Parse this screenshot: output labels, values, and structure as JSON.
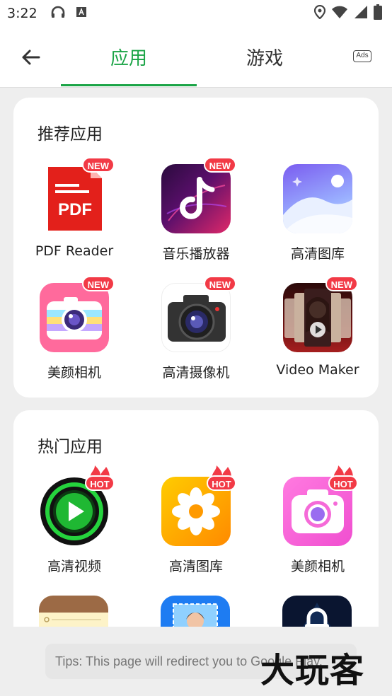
{
  "status_bar": {
    "time": "3:22"
  },
  "header": {
    "back_icon": "arrow-left-icon",
    "tabs": [
      {
        "label": "应用",
        "active": true
      },
      {
        "label": "游戏",
        "active": false
      }
    ],
    "ads_label": "Ads"
  },
  "colors": {
    "accent": "#1aa446",
    "badge": "#f23a46"
  },
  "sections": [
    {
      "title": "推荐应用",
      "apps": [
        {
          "label": "PDF Reader",
          "badge": "NEW",
          "icon": "pdf-icon"
        },
        {
          "label": "音乐播放器",
          "badge": "NEW",
          "icon": "music-note-icon"
        },
        {
          "label": "高清图库",
          "badge": "",
          "icon": "gallery-icon"
        },
        {
          "label": "美颜相机",
          "badge": "NEW",
          "icon": "beauty-camera-icon"
        },
        {
          "label": "高清摄像机",
          "badge": "NEW",
          "icon": "camera-icon"
        },
        {
          "label": "Video Maker",
          "badge": "NEW",
          "icon": "video-maker-icon"
        }
      ]
    },
    {
      "title": "热门应用",
      "apps": [
        {
          "label": "高清视频",
          "badge": "HOT",
          "icon": "play-icon"
        },
        {
          "label": "高清图库",
          "badge": "HOT",
          "icon": "flower-icon"
        },
        {
          "label": "美颜相机",
          "badge": "HOT",
          "icon": "camera-pink-icon"
        }
      ]
    }
  ],
  "tips": "Tips: This page will redirect you to Google Play.",
  "watermark": "大玩客"
}
